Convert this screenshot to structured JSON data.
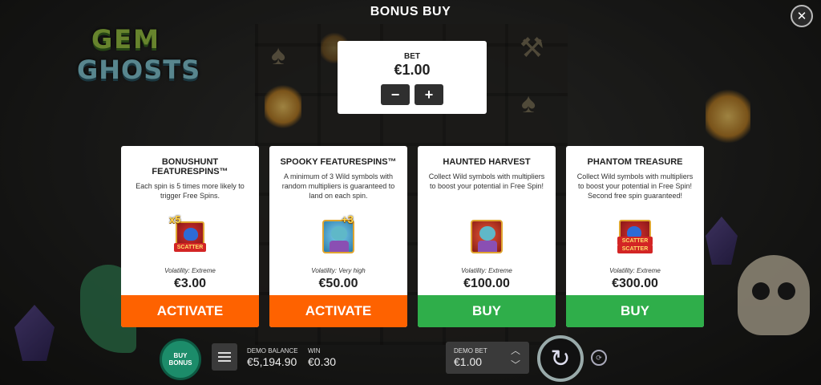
{
  "header": {
    "title": "BONUS BUY",
    "close_icon": "close-icon"
  },
  "logo": {
    "line1": "GEM",
    "line2": "GHOSTS"
  },
  "bet": {
    "label": "BET",
    "value": "€1.00",
    "decrease": "−",
    "increase": "+"
  },
  "cards": [
    {
      "title": "BONUSHUNT FEATURESPINS™",
      "description": "Each spin is 5 times more likely to trigger Free Spins.",
      "multiplier": "x5",
      "scatter_label": "SCATTER",
      "volatility": "Volatility: Extreme",
      "price": "€3.00",
      "button": "ACTIVATE",
      "button_color": "#fe6200"
    },
    {
      "title": "SPOOKY FEATURESPINS™",
      "description": "A minimum of 3 Wild symbols with random multipliers is guaranteed to land on each spin.",
      "multiplier": "+3",
      "volatility": "Volatility: Very high",
      "price": "€50.00",
      "button": "ACTIVATE",
      "button_color": "#fe6200"
    },
    {
      "title": "HAUNTED HARVEST",
      "description": "Collect Wild symbols with multipliers to boost your potential in Free Spin!",
      "volatility": "Volatility: Extreme",
      "price": "€100.00",
      "button": "BUY",
      "button_color": "#2fae4a"
    },
    {
      "title": "PHANTOM TREASURE",
      "description": "Collect Wild symbols with multipliers to boost your potential in Free Spin! Second free spin guaranteed!",
      "scatter_label": "SCATTER",
      "scatter_label_2": "SCATTER",
      "volatility": "Volatility: Extreme",
      "price": "€300.00",
      "button": "BUY",
      "button_color": "#2fae4a"
    }
  ],
  "bottom_bar": {
    "buy_bonus": "BUY BONUS",
    "demo_balance_label": "DEMO BALANCE",
    "demo_balance_value": "€5,194.90",
    "win_label": "WIN",
    "win_value": "€0.30",
    "demo_bet_label": "DEMO BET",
    "demo_bet_value": "€1.00"
  }
}
